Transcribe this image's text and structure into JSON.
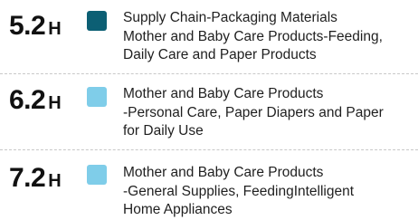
{
  "colors": {
    "dark_teal": "#0c5f74",
    "light_blue": "#7fcde9",
    "divider": "#c8c8c8"
  },
  "entries": [
    {
      "date": "5.2",
      "unit": "H",
      "swatch_color": "#0c5f74",
      "lines": [
        "Supply Chain-Packaging Materials",
        "Mother and Baby Care Products-Feeding,",
        "Daily Care and Paper Products"
      ]
    },
    {
      "date": "6.2",
      "unit": "H",
      "swatch_color": "#7fcde9",
      "lines": [
        "Mother and Baby Care Products",
        "-Personal Care, Paper Diapers and Paper",
        "for Daily Use"
      ]
    },
    {
      "date": "7.2",
      "unit": "H",
      "swatch_color": "#7fcde9",
      "lines": [
        "Mother and Baby Care Products",
        "-General Supplies, FeedingIntelligent",
        "Home Appliances"
      ]
    }
  ]
}
